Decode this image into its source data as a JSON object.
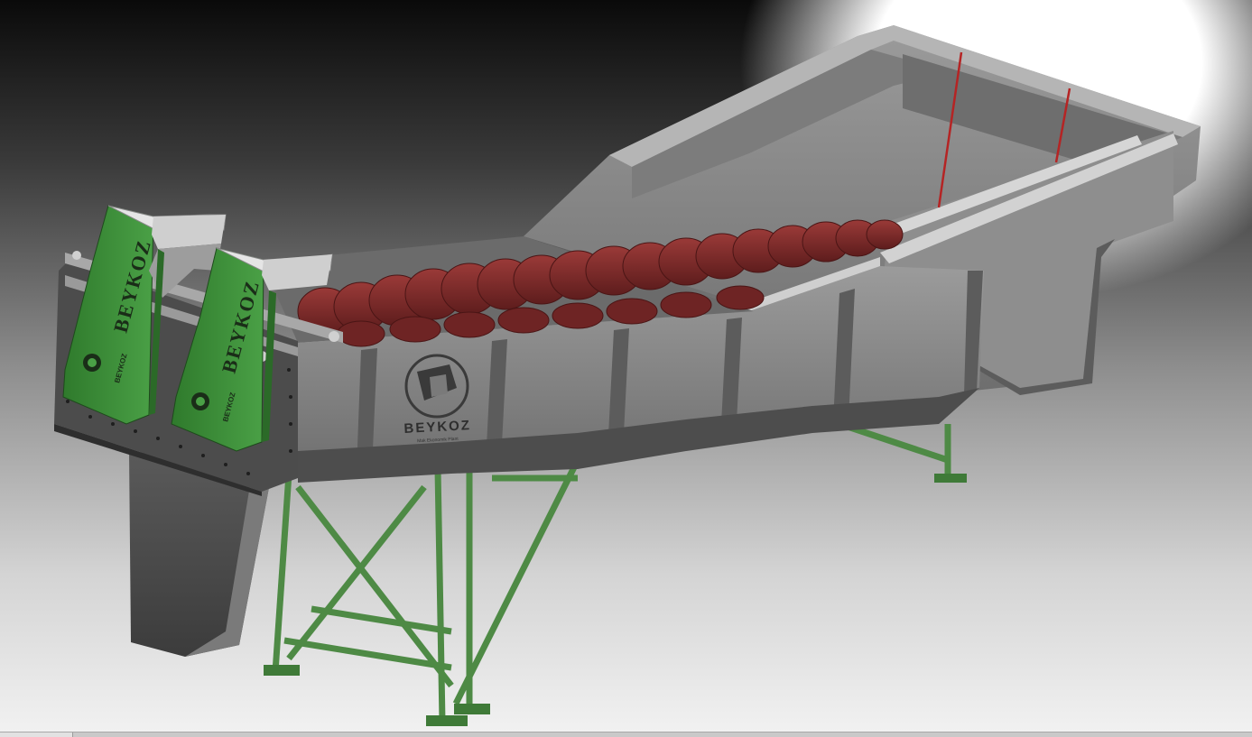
{
  "model": {
    "brand_left_unit": "BEYKOZ",
    "brand_right_unit": "BEYKOZ",
    "brand_small_left": "BEYKOZ",
    "brand_small_right": "BEYKOZ",
    "brand_trough": "BEYKOZ",
    "tagline_trough": "Mak Ekonomik Plant"
  },
  "colors": {
    "steel": "#8c8c8c",
    "screw": "#7a2a2a",
    "frame": "#4f8a46",
    "drive": "#3f8b3a"
  }
}
